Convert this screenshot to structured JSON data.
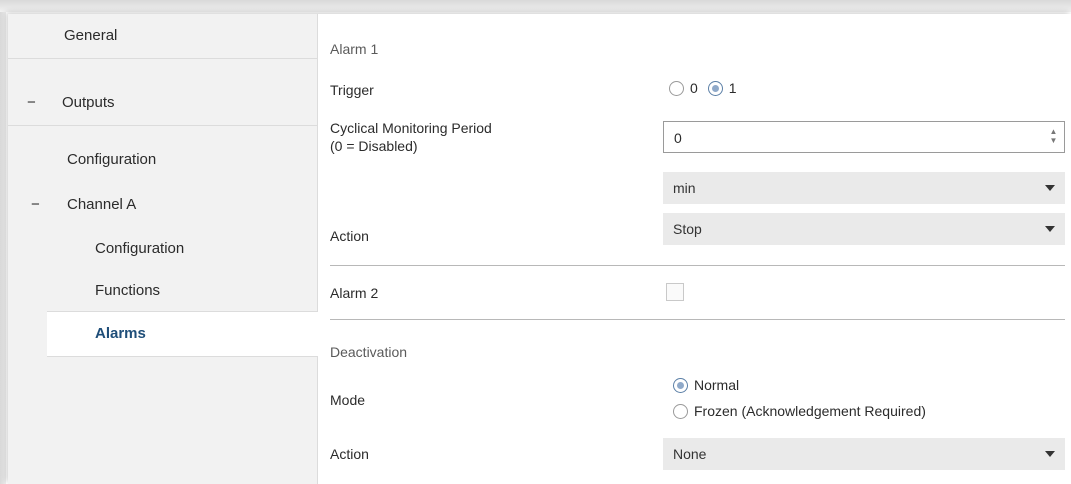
{
  "sidebar": {
    "items": [
      {
        "label": "General"
      },
      {
        "label": "Outputs",
        "prefix": "−"
      },
      {
        "label": "Configuration"
      },
      {
        "label": "Channel A",
        "prefix": "−"
      },
      {
        "label": "Configuration"
      },
      {
        "label": "Functions"
      },
      {
        "label": "Alarms"
      }
    ]
  },
  "alarm1": {
    "title": "Alarm 1",
    "trigger_label": "Trigger",
    "trigger_options": [
      "0",
      "1"
    ],
    "trigger_selected": "1",
    "period_label_line1": "Cyclical Monitoring Period",
    "period_label_line2": "(0 = Disabled)",
    "period_value": "0",
    "period_unit": "min",
    "action_label": "Action",
    "action_value": "Stop"
  },
  "alarm2": {
    "label": "Alarm 2",
    "checked": false
  },
  "deactivation": {
    "title": "Deactivation",
    "mode_label": "Mode",
    "mode_options": [
      "Normal",
      "Frozen (Acknowledgement Required)"
    ],
    "mode_selected": "Normal",
    "action_label": "Action",
    "action_value": "None"
  },
  "icons": {
    "spin_up": "▲",
    "spin_down": "▼"
  },
  "colors": {
    "selected_nav_text": "#1f4e79",
    "sidebar_bg": "#f2f2f2",
    "dropdown_bg": "#eaeaea"
  }
}
